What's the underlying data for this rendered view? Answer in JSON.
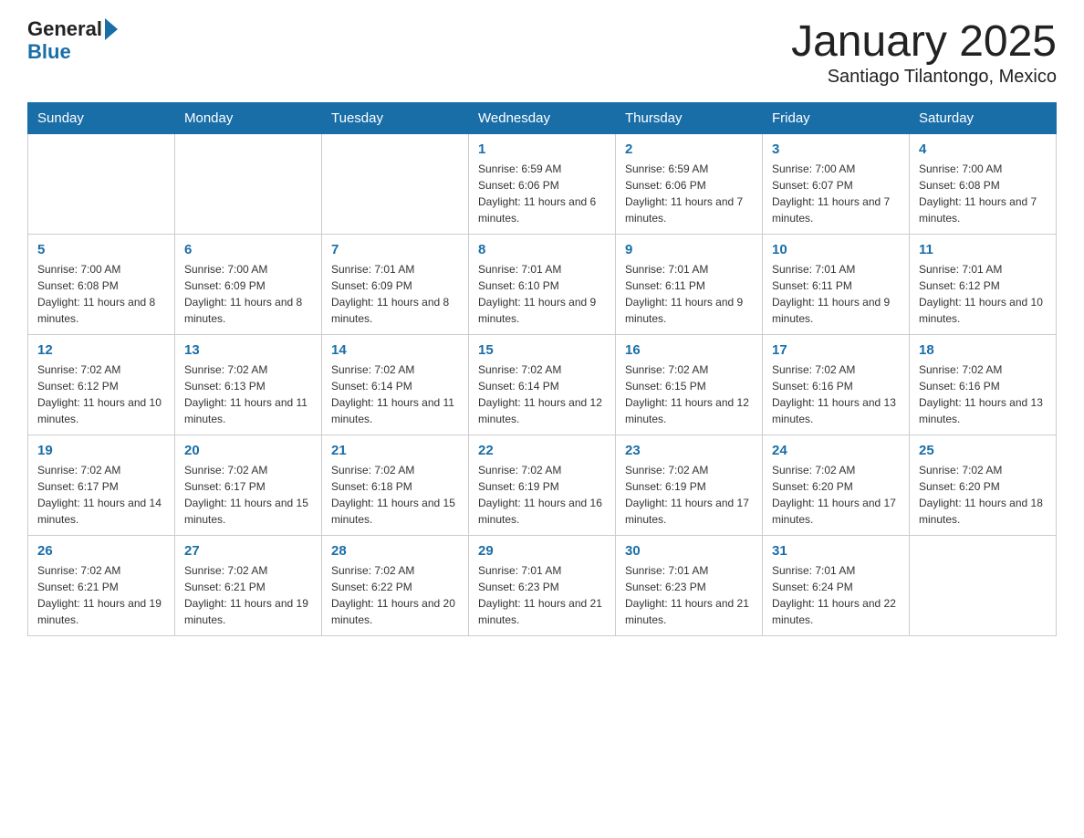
{
  "header": {
    "logo_general": "General",
    "logo_blue": "Blue",
    "title": "January 2025",
    "subtitle": "Santiago Tilantongo, Mexico"
  },
  "weekdays": [
    "Sunday",
    "Monday",
    "Tuesday",
    "Wednesday",
    "Thursday",
    "Friday",
    "Saturday"
  ],
  "weeks": [
    [
      {
        "day": "",
        "info": ""
      },
      {
        "day": "",
        "info": ""
      },
      {
        "day": "",
        "info": ""
      },
      {
        "day": "1",
        "info": "Sunrise: 6:59 AM\nSunset: 6:06 PM\nDaylight: 11 hours and 6 minutes."
      },
      {
        "day": "2",
        "info": "Sunrise: 6:59 AM\nSunset: 6:06 PM\nDaylight: 11 hours and 7 minutes."
      },
      {
        "day": "3",
        "info": "Sunrise: 7:00 AM\nSunset: 6:07 PM\nDaylight: 11 hours and 7 minutes."
      },
      {
        "day": "4",
        "info": "Sunrise: 7:00 AM\nSunset: 6:08 PM\nDaylight: 11 hours and 7 minutes."
      }
    ],
    [
      {
        "day": "5",
        "info": "Sunrise: 7:00 AM\nSunset: 6:08 PM\nDaylight: 11 hours and 8 minutes."
      },
      {
        "day": "6",
        "info": "Sunrise: 7:00 AM\nSunset: 6:09 PM\nDaylight: 11 hours and 8 minutes."
      },
      {
        "day": "7",
        "info": "Sunrise: 7:01 AM\nSunset: 6:09 PM\nDaylight: 11 hours and 8 minutes."
      },
      {
        "day": "8",
        "info": "Sunrise: 7:01 AM\nSunset: 6:10 PM\nDaylight: 11 hours and 9 minutes."
      },
      {
        "day": "9",
        "info": "Sunrise: 7:01 AM\nSunset: 6:11 PM\nDaylight: 11 hours and 9 minutes."
      },
      {
        "day": "10",
        "info": "Sunrise: 7:01 AM\nSunset: 6:11 PM\nDaylight: 11 hours and 9 minutes."
      },
      {
        "day": "11",
        "info": "Sunrise: 7:01 AM\nSunset: 6:12 PM\nDaylight: 11 hours and 10 minutes."
      }
    ],
    [
      {
        "day": "12",
        "info": "Sunrise: 7:02 AM\nSunset: 6:12 PM\nDaylight: 11 hours and 10 minutes."
      },
      {
        "day": "13",
        "info": "Sunrise: 7:02 AM\nSunset: 6:13 PM\nDaylight: 11 hours and 11 minutes."
      },
      {
        "day": "14",
        "info": "Sunrise: 7:02 AM\nSunset: 6:14 PM\nDaylight: 11 hours and 11 minutes."
      },
      {
        "day": "15",
        "info": "Sunrise: 7:02 AM\nSunset: 6:14 PM\nDaylight: 11 hours and 12 minutes."
      },
      {
        "day": "16",
        "info": "Sunrise: 7:02 AM\nSunset: 6:15 PM\nDaylight: 11 hours and 12 minutes."
      },
      {
        "day": "17",
        "info": "Sunrise: 7:02 AM\nSunset: 6:16 PM\nDaylight: 11 hours and 13 minutes."
      },
      {
        "day": "18",
        "info": "Sunrise: 7:02 AM\nSunset: 6:16 PM\nDaylight: 11 hours and 13 minutes."
      }
    ],
    [
      {
        "day": "19",
        "info": "Sunrise: 7:02 AM\nSunset: 6:17 PM\nDaylight: 11 hours and 14 minutes."
      },
      {
        "day": "20",
        "info": "Sunrise: 7:02 AM\nSunset: 6:17 PM\nDaylight: 11 hours and 15 minutes."
      },
      {
        "day": "21",
        "info": "Sunrise: 7:02 AM\nSunset: 6:18 PM\nDaylight: 11 hours and 15 minutes."
      },
      {
        "day": "22",
        "info": "Sunrise: 7:02 AM\nSunset: 6:19 PM\nDaylight: 11 hours and 16 minutes."
      },
      {
        "day": "23",
        "info": "Sunrise: 7:02 AM\nSunset: 6:19 PM\nDaylight: 11 hours and 17 minutes."
      },
      {
        "day": "24",
        "info": "Sunrise: 7:02 AM\nSunset: 6:20 PM\nDaylight: 11 hours and 17 minutes."
      },
      {
        "day": "25",
        "info": "Sunrise: 7:02 AM\nSunset: 6:20 PM\nDaylight: 11 hours and 18 minutes."
      }
    ],
    [
      {
        "day": "26",
        "info": "Sunrise: 7:02 AM\nSunset: 6:21 PM\nDaylight: 11 hours and 19 minutes."
      },
      {
        "day": "27",
        "info": "Sunrise: 7:02 AM\nSunset: 6:21 PM\nDaylight: 11 hours and 19 minutes."
      },
      {
        "day": "28",
        "info": "Sunrise: 7:02 AM\nSunset: 6:22 PM\nDaylight: 11 hours and 20 minutes."
      },
      {
        "day": "29",
        "info": "Sunrise: 7:01 AM\nSunset: 6:23 PM\nDaylight: 11 hours and 21 minutes."
      },
      {
        "day": "30",
        "info": "Sunrise: 7:01 AM\nSunset: 6:23 PM\nDaylight: 11 hours and 21 minutes."
      },
      {
        "day": "31",
        "info": "Sunrise: 7:01 AM\nSunset: 6:24 PM\nDaylight: 11 hours and 22 minutes."
      },
      {
        "day": "",
        "info": ""
      }
    ]
  ]
}
